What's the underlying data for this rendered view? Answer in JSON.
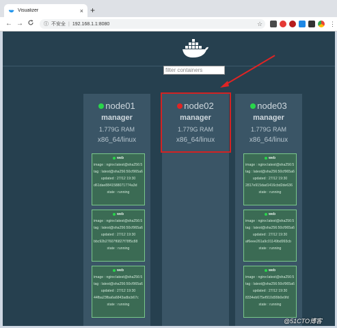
{
  "browser": {
    "tab_title": "Visualizer",
    "tab_close": "×",
    "new_tab": "+",
    "back": "←",
    "forward": "→",
    "reload": "C",
    "security_label": "不安全",
    "url": "192.168.1.1:8080",
    "star": "☆",
    "menu": "⋮"
  },
  "page": {
    "filter_placeholder": "filter containers",
    "nodes": [
      {
        "name": "node01",
        "status_color": "#29d64b",
        "role": "manager",
        "ram": "1.779G RAM",
        "arch": "x86_64/linux",
        "tasks": [
          {
            "service": "web",
            "image": "image : nginx:latest@sha256:5",
            "tag": "tag : latest@sha256:50cf965a6",
            "updated": "updated : 27/12 19:30",
            "id": "d61dae8841588071774a3d",
            "state": "state : running"
          },
          {
            "service": "web",
            "image": "image : nginx:latest@sha256:5",
            "tag": "tag : latest@sha256:50cf965a6",
            "updated": "updated : 27/12 19:30",
            "id": "bbc92b27607f6827f78f5c88",
            "state": "state : running"
          },
          {
            "service": "web",
            "image": "image : nginx:latest@sha256:5",
            "tag": "tag : latest@sha256:50cf965a6",
            "updated": "updated : 27/12 19:30",
            "id": "44fba23fba6a6843adbcb67c",
            "state": "state : running"
          }
        ]
      },
      {
        "name": "node02",
        "status_color": "#e02424",
        "role": "manager",
        "ram": "1.779G RAM",
        "arch": "x86_64/linux",
        "tasks": []
      },
      {
        "name": "node03",
        "status_color": "#29d64b",
        "role": "manager",
        "ram": "1.779G RAM",
        "arch": "x86_64/linux",
        "tasks": [
          {
            "service": "web",
            "image": "image : nginx:latest@sha256:5",
            "tag": "tag : latest@sha256:50cf965a6",
            "updated": "updated : 27/12 19:30",
            "id": "2817e915dad1416cbd2de636",
            "state": "state : running"
          },
          {
            "service": "web",
            "image": "image : nginx:latest@sha256:5",
            "tag": "tag : latest@sha256:50cf965a6",
            "updated": "updated : 27/12 19:30",
            "id": "af6eee261a9c01149bd993cb",
            "state": "state : running"
          },
          {
            "service": "web",
            "image": "image : nginx:latest@sha256:5",
            "tag": "tag : latest@sha256:50cf965a6",
            "updated": "updated : 27/12 19:30",
            "id": "8334eb675ef910d99b0e9fd",
            "state": "state : running"
          }
        ]
      }
    ]
  },
  "watermark": "@51CTO博客",
  "colors": {
    "page_bg": "#26404f",
    "node_bg": "#3a5566",
    "task_bg": "#3b6b54",
    "task_border": "#7ac88a",
    "highlight": "#d32222"
  },
  "icons": [
    "docker-whale-icon",
    "red-arrow-icon",
    "status-dot-icon"
  ]
}
